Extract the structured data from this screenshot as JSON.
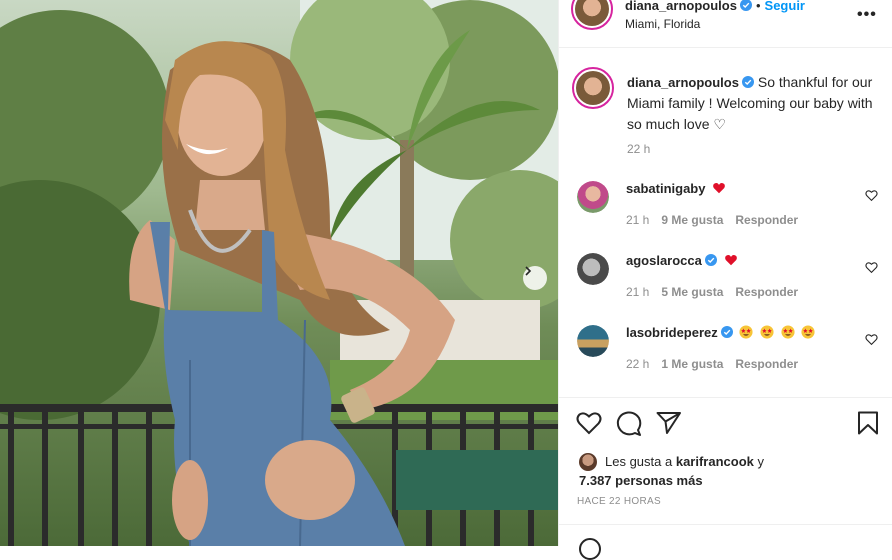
{
  "post": {
    "username": "diana_arnopoulos",
    "follow_label": "Seguir",
    "separator": "•",
    "location": "Miami, Florida",
    "more_label": "•••"
  },
  "caption": {
    "username": "diana_arnopoulos",
    "text": "So thankful for our Miami family ! Welcoming our baby with so much love ♡",
    "time": "22 h"
  },
  "comments": [
    {
      "username": "sabatinigaby",
      "verified": false,
      "emoji": "red-heart",
      "time": "21 h",
      "likes": "9 Me gusta",
      "reply": "Responder"
    },
    {
      "username": "agoslarocca",
      "verified": true,
      "emoji": "red-heart",
      "time": "21 h",
      "likes": "5 Me gusta",
      "reply": "Responder"
    },
    {
      "username": "lasobrideperez",
      "verified": true,
      "emoji": "star-struck x4",
      "time": "22 h",
      "likes": "1 Me gusta",
      "reply": "Responder"
    }
  ],
  "likes": {
    "prefix": "Les gusta a",
    "user": "karifrancook",
    "joiner": "y",
    "others": "7.387 personas más"
  },
  "posted_ago": "HACE 22 HORAS",
  "colors": {
    "accent": "#0095f6",
    "verified": "#3897f0",
    "heart": "#ed4956",
    "text": "#262626",
    "muted": "#8e8e8e"
  }
}
